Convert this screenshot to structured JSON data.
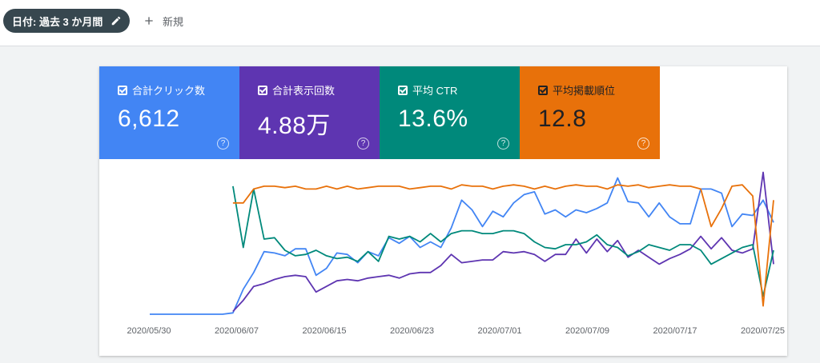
{
  "toolbar": {
    "date_chip_label": "日付: 過去 3 か月間",
    "new_label": "新規"
  },
  "metrics": [
    {
      "key": "clicks",
      "label": "合計クリック数",
      "value": "6,612",
      "color": "#4285f4",
      "checked": true
    },
    {
      "key": "impressions",
      "label": "合計表示回数",
      "value": "4.88万",
      "color": "#5e35b1",
      "checked": true
    },
    {
      "key": "ctr",
      "label": "平均 CTR",
      "value": "13.6%",
      "color": "#00897b",
      "checked": true
    },
    {
      "key": "position",
      "label": "平均掲載順位",
      "value": "12.8",
      "color": "#e8710a",
      "checked": true
    }
  ],
  "chart_data": {
    "type": "line",
    "x_ticks": [
      "2020/05/30",
      "2020/06/07",
      "2020/06/15",
      "2020/06/23",
      "2020/07/01",
      "2020/07/09",
      "2020/07/17",
      "2020/07/25"
    ],
    "grid": false,
    "normalized_scale": true,
    "series": [
      {
        "color": "#4285f4",
        "values": [
          0,
          0,
          0,
          0,
          0,
          0,
          0,
          0,
          0.01,
          0.18,
          0.3,
          0.45,
          0.44,
          0.42,
          0.47,
          0.47,
          0.28,
          0.33,
          0.44,
          0.43,
          0.37,
          0.45,
          0.42,
          0.55,
          0.51,
          0.56,
          0.48,
          0.52,
          0.48,
          0.62,
          0.82,
          0.75,
          0.63,
          0.74,
          0.7,
          0.8,
          0.86,
          0.88,
          0.72,
          0.75,
          0.7,
          0.75,
          0.73,
          0.76,
          0.8,
          0.98,
          0.81,
          0.8,
          0.7,
          0.8,
          0.7,
          0.65,
          0.65,
          0.9,
          0.9,
          0.87,
          0.63,
          0.72,
          0.71,
          0.82,
          0.66
        ]
      },
      {
        "color": "#5e35b1",
        "values": [
          null,
          null,
          null,
          null,
          null,
          null,
          null,
          null,
          0.02,
          0.1,
          0.2,
          0.22,
          0.25,
          0.27,
          0.28,
          0.27,
          0.16,
          0.2,
          0.24,
          0.25,
          0.24,
          0.26,
          0.27,
          0.28,
          0.26,
          0.29,
          0.3,
          0.3,
          0.35,
          0.43,
          0.37,
          0.38,
          0.39,
          0.39,
          0.45,
          0.44,
          0.45,
          0.43,
          0.38,
          0.43,
          0.43,
          0.54,
          0.44,
          0.54,
          0.45,
          0.53,
          0.41,
          0.46,
          0.41,
          0.36,
          0.4,
          0.43,
          0.47,
          0.56,
          0.47,
          0.55,
          0.46,
          0.44,
          0.47,
          1.02,
          0.36
        ]
      },
      {
        "color": "#00897b",
        "values": [
          null,
          null,
          null,
          null,
          null,
          null,
          null,
          null,
          0.92,
          0.48,
          0.9,
          0.54,
          0.55,
          0.46,
          0.42,
          0.43,
          0.46,
          0.42,
          0.4,
          0.41,
          0.38,
          0.45,
          0.38,
          0.56,
          0.54,
          0.56,
          0.52,
          0.58,
          0.52,
          0.58,
          0.6,
          0.6,
          0.58,
          0.58,
          0.6,
          0.6,
          0.58,
          0.52,
          0.48,
          0.47,
          0.5,
          0.5,
          0.52,
          0.57,
          0.5,
          0.48,
          0.42,
          0.45,
          0.5,
          0.48,
          0.46,
          0.5,
          0.5,
          0.46,
          0.36,
          0.4,
          0.44,
          0.48,
          0.5,
          0.13,
          0.46
        ]
      },
      {
        "color": "#e8710a",
        "values": [
          null,
          null,
          null,
          null,
          null,
          null,
          null,
          null,
          0.8,
          0.8,
          0.9,
          0.92,
          0.92,
          0.91,
          0.92,
          0.9,
          0.9,
          0.92,
          0.9,
          0.92,
          0.9,
          0.91,
          0.92,
          0.92,
          0.92,
          0.9,
          0.91,
          0.92,
          0.92,
          0.9,
          0.93,
          0.92,
          0.92,
          0.9,
          0.92,
          0.93,
          0.92,
          0.9,
          0.92,
          0.9,
          0.92,
          0.93,
          0.92,
          0.92,
          0.9,
          0.93,
          0.92,
          0.93,
          0.91,
          0.92,
          0.93,
          0.92,
          0.92,
          0.9,
          0.63,
          0.76,
          0.92,
          0.93,
          0.85,
          0.06,
          0.82
        ]
      }
    ]
  }
}
